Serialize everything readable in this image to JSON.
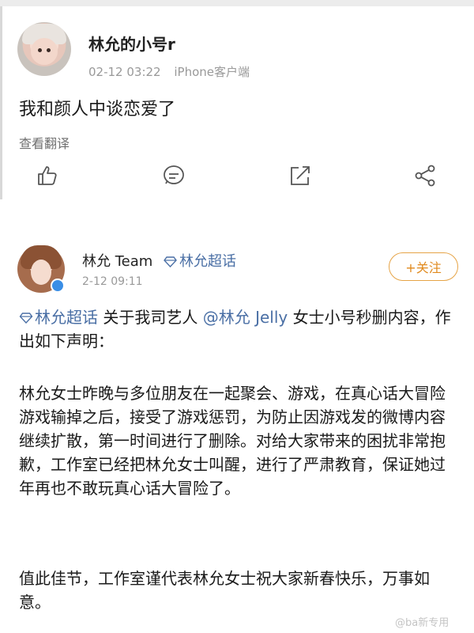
{
  "post1": {
    "username": "林允的小号r",
    "date": "02-12 03:22",
    "source": "iPhone客户端",
    "text": "我和颜人中谈恋爱了",
    "translate_label": "查看翻译",
    "actions": [
      "like-icon",
      "comment-icon",
      "repost-icon",
      "share-icon"
    ]
  },
  "post2": {
    "username": "林允 Team",
    "topic": "林允超话",
    "date": "2-12 09:11",
    "follow_label": "+关注",
    "line1_topic": "林允超话",
    "line1_text": " 关于我司艺人 ",
    "mention": "@林允 Jelly",
    "line1_rest": " 女士小号秒删内容，作出如下声明：",
    "paragraph2": "林允女士昨晚与多位朋友在一起聚会、游戏，在真心话大冒险游戏输掉之后，接受了游戏惩罚，为防止因游戏发的微博内容继续扩散，第一时间进行了删除。对给大家带来的困扰非常抱歉，工作室已经把林允女士叫醒，进行了严肃教育，保证她过年再也不敢玩真心话大冒险了。",
    "paragraph3": "值此佳节，工作室谨代表林允女士祝大家新春快乐，万事如意。"
  },
  "colors": {
    "link": "#4a6fa5",
    "follow": "#e08a1e",
    "meta": "#999999"
  },
  "watermark": "@ba新专用"
}
